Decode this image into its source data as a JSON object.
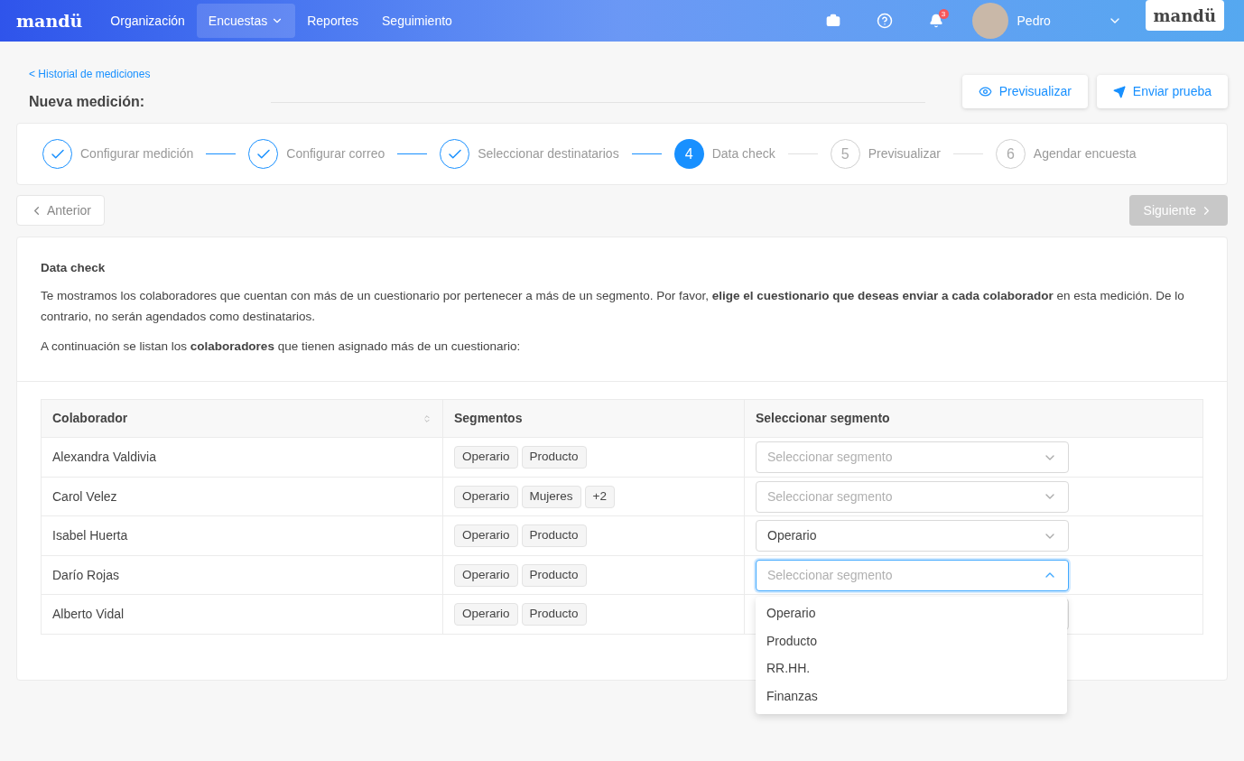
{
  "navbar": {
    "logo": "mandü",
    "items": [
      {
        "label": "Organización",
        "selected": false,
        "has_menu": false
      },
      {
        "label": "Encuestas",
        "selected": true,
        "has_menu": true
      },
      {
        "label": "Reportes",
        "selected": false,
        "has_menu": false
      },
      {
        "label": "Seguimiento",
        "selected": false,
        "has_menu": false
      }
    ],
    "notification_count": "3",
    "user": "Pedro",
    "brand": "mandü"
  },
  "breadcrumb": "< Historial de mediciones",
  "title": "Nueva medición:",
  "actions": [
    {
      "label": "Previsualizar",
      "kind": "preview"
    },
    {
      "label": "Enviar prueba",
      "kind": "send"
    }
  ],
  "steps": [
    {
      "label": "Configurar medición",
      "done": true,
      "selected": false
    },
    {
      "label": "Configurar correo",
      "done": true,
      "selected": false
    },
    {
      "label": "Seleccionar destinatarios",
      "done": true,
      "selected": false
    },
    {
      "label": "Data check",
      "done": false,
      "selected": true,
      "number": "4"
    },
    {
      "label": "Previsualizar",
      "done": false,
      "selected": false,
      "number": "5"
    },
    {
      "label": "Agendar encuesta",
      "done": false,
      "selected": false,
      "number": "6"
    }
  ],
  "prev_button": {
    "label": "Anterior",
    "disabled": false
  },
  "next_button": {
    "label": "Siguiente",
    "disabled": true
  },
  "section": {
    "title": "Data check",
    "paragraphs": [
      "Te mostramos los colaboradores que cuentan con más de un cuestionario por pertenecer a más de un segmento. Por favor, **elige el cuestionario que deseas enviar a cada colaborador** en esta medición. De lo contrario, no serán agendados como destinatarios.",
      "A continuación se listan los **colaboradores** que tienen asignado más de un cuestionario:"
    ]
  },
  "table": {
    "columns": [
      "Colaborador",
      "Segmentos",
      "Seleccionar segmento"
    ],
    "rows": [
      {
        "name": "Alexandra Valdivia",
        "segments": [
          "Operario",
          "Producto"
        ],
        "select": {
          "placeholder": "Seleccionar segmento",
          "open": false
        }
      },
      {
        "name": "Carol Velez",
        "segments": [
          "Operario",
          "Mujeres",
          "+2"
        ],
        "select": {
          "placeholder": "Seleccionar segmento",
          "open": false
        }
      },
      {
        "name": "Isabel Huerta",
        "segments": [
          "Operario",
          "Producto"
        ],
        "select": {
          "value": "Operario",
          "open": false
        }
      },
      {
        "name": "Darío Rojas",
        "segments": [
          "Operario",
          "Producto"
        ],
        "select": {
          "placeholder": "Seleccionar segmento",
          "open": true,
          "options": [
            "Operario",
            "Producto",
            "RR.HH.",
            "Finanzas"
          ]
        }
      },
      {
        "name": "Alberto Vidal",
        "segments": [
          "Operario",
          "Producto"
        ],
        "select": {
          "open": false
        }
      }
    ]
  }
}
